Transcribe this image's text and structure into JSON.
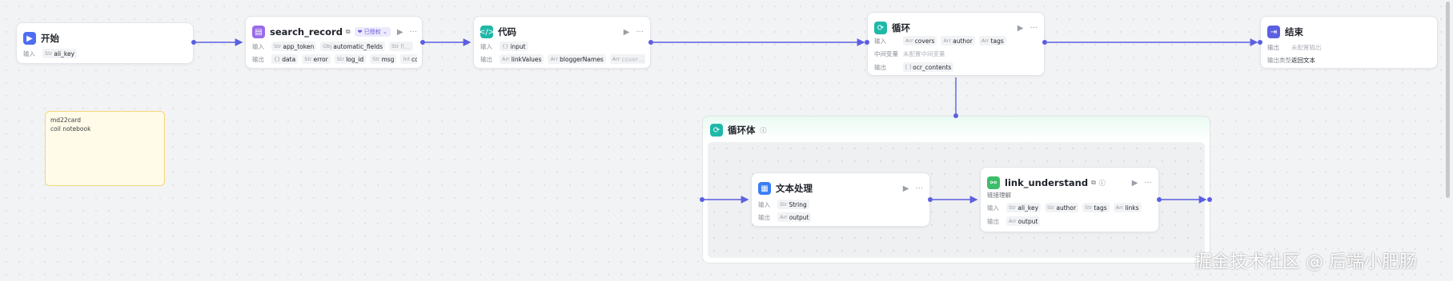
{
  "nodes": {
    "start": {
      "title": "开始",
      "rows": [
        {
          "label": "输入",
          "tags": [
            {
              "type": "Str",
              "name": "ali_key"
            }
          ]
        }
      ]
    },
    "search": {
      "title": "search_record",
      "badge": "❤ 已授权 ⌄",
      "input": {
        "label": "输入",
        "tags": [
          {
            "type": "Str",
            "name": "app_token"
          },
          {
            "type": "Obj",
            "name": "automatic_fields"
          },
          {
            "type": "Str",
            "name": "fi…"
          }
        ],
        "more": "···"
      },
      "output": {
        "label": "输出",
        "tags": [
          {
            "type": "{}",
            "name": "data"
          },
          {
            "type": "Str",
            "name": "error"
          },
          {
            "type": "Str",
            "name": "log_id"
          },
          {
            "type": "Str",
            "name": "msg"
          },
          {
            "type": "Int",
            "name": "code"
          }
        ]
      }
    },
    "code": {
      "title": "代码",
      "input": {
        "label": "输入",
        "tags": [
          {
            "type": "{}",
            "name": "input"
          }
        ]
      },
      "output": {
        "label": "输出",
        "tags": [
          {
            "type": "Arr",
            "name": "linkValues"
          },
          {
            "type": "Arr",
            "name": "bloggerNames"
          },
          {
            "type": "Arr",
            "name": "cover…"
          }
        ]
      }
    },
    "loop": {
      "title": "循环",
      "input": {
        "label": "输入",
        "tags": [
          {
            "type": "Arr",
            "name": "covers"
          },
          {
            "type": "Arr",
            "name": "author"
          },
          {
            "type": "Arr",
            "name": "tags"
          }
        ]
      },
      "middle": {
        "label": "中间变量",
        "text": "未配置中间变量"
      },
      "output": {
        "label": "输出",
        "tags": [
          {
            "type": "[ ]",
            "name": "ocr_contents"
          }
        ]
      }
    },
    "end": {
      "title": "结束",
      "output": {
        "label": "输出",
        "text": "未配置输出"
      },
      "mode": {
        "label": "输出类型",
        "text": "返回文本"
      }
    },
    "text": {
      "title": "文本处理",
      "input": {
        "label": "输入",
        "tags": [
          {
            "type": "Str",
            "name": "String"
          }
        ]
      },
      "output": {
        "label": "输出",
        "tags": [
          {
            "type": "Arr",
            "name": "output"
          }
        ]
      }
    },
    "link": {
      "title": "link_understand",
      "desc": "链接理解",
      "input": {
        "label": "输入",
        "tags": [
          {
            "type": "Str",
            "name": "ali_key"
          },
          {
            "type": "Str",
            "name": "author"
          },
          {
            "type": "Str",
            "name": "tags"
          },
          {
            "type": "Arr",
            "name": "links"
          }
        ]
      },
      "output": {
        "label": "输出",
        "tags": [
          {
            "type": "Arr",
            "name": "output"
          }
        ]
      }
    }
  },
  "loop_body": {
    "title": "循环体",
    "info_icon": "ⓘ"
  },
  "note": {
    "line1": "md22card",
    "line2": "coil notebook"
  },
  "watermark": "掘金技术社区 @ 后端小肥肠",
  "colors": {
    "edge": "#5b5fe0",
    "start_icon": "#4e6ef2",
    "search_icon": "#9b6be8",
    "code_icon": "#1fb8a8",
    "loop_icon": "#1fb8a8",
    "end_icon": "#5b5fe0",
    "text_icon": "#3a7df6",
    "link_icon": "#3dbd6a"
  },
  "icons": {
    "start": "play-icon",
    "search": "plugin-icon",
    "code": "code-icon",
    "loop": "loop-icon",
    "end": "stop-icon",
    "text": "text-icon",
    "link": "link-icon",
    "run": "run-icon",
    "more": "more-icon"
  }
}
